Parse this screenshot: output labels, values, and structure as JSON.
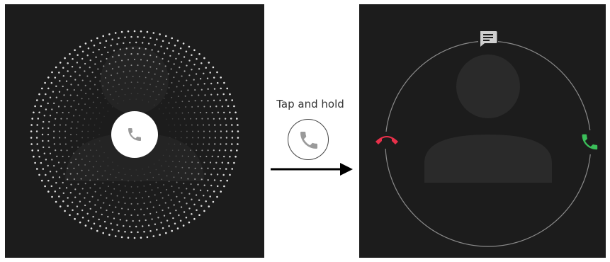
{
  "instruction": {
    "label": "Tap and hold"
  },
  "left_screen": {
    "state": "incoming-call-idle",
    "center_button_icon": "phone-icon",
    "center_button_color": "#ffffff",
    "icon_color": "#9a9a9a",
    "background_color": "#1c1c1c",
    "ring_dot_color": "#e6e6e6"
  },
  "hint": {
    "icon": "phone-icon",
    "icon_color": "#9a9a9a"
  },
  "right_screen": {
    "state": "incoming-call-active",
    "top_action_icon": "message-icon",
    "decline_icon": "hang-up-icon",
    "decline_color": "#e8304a",
    "accept_icon": "phone-icon",
    "accept_color": "#3bbf5a",
    "ring_color": "#8a8a8a",
    "avatar_color": "#2a2a2a"
  }
}
